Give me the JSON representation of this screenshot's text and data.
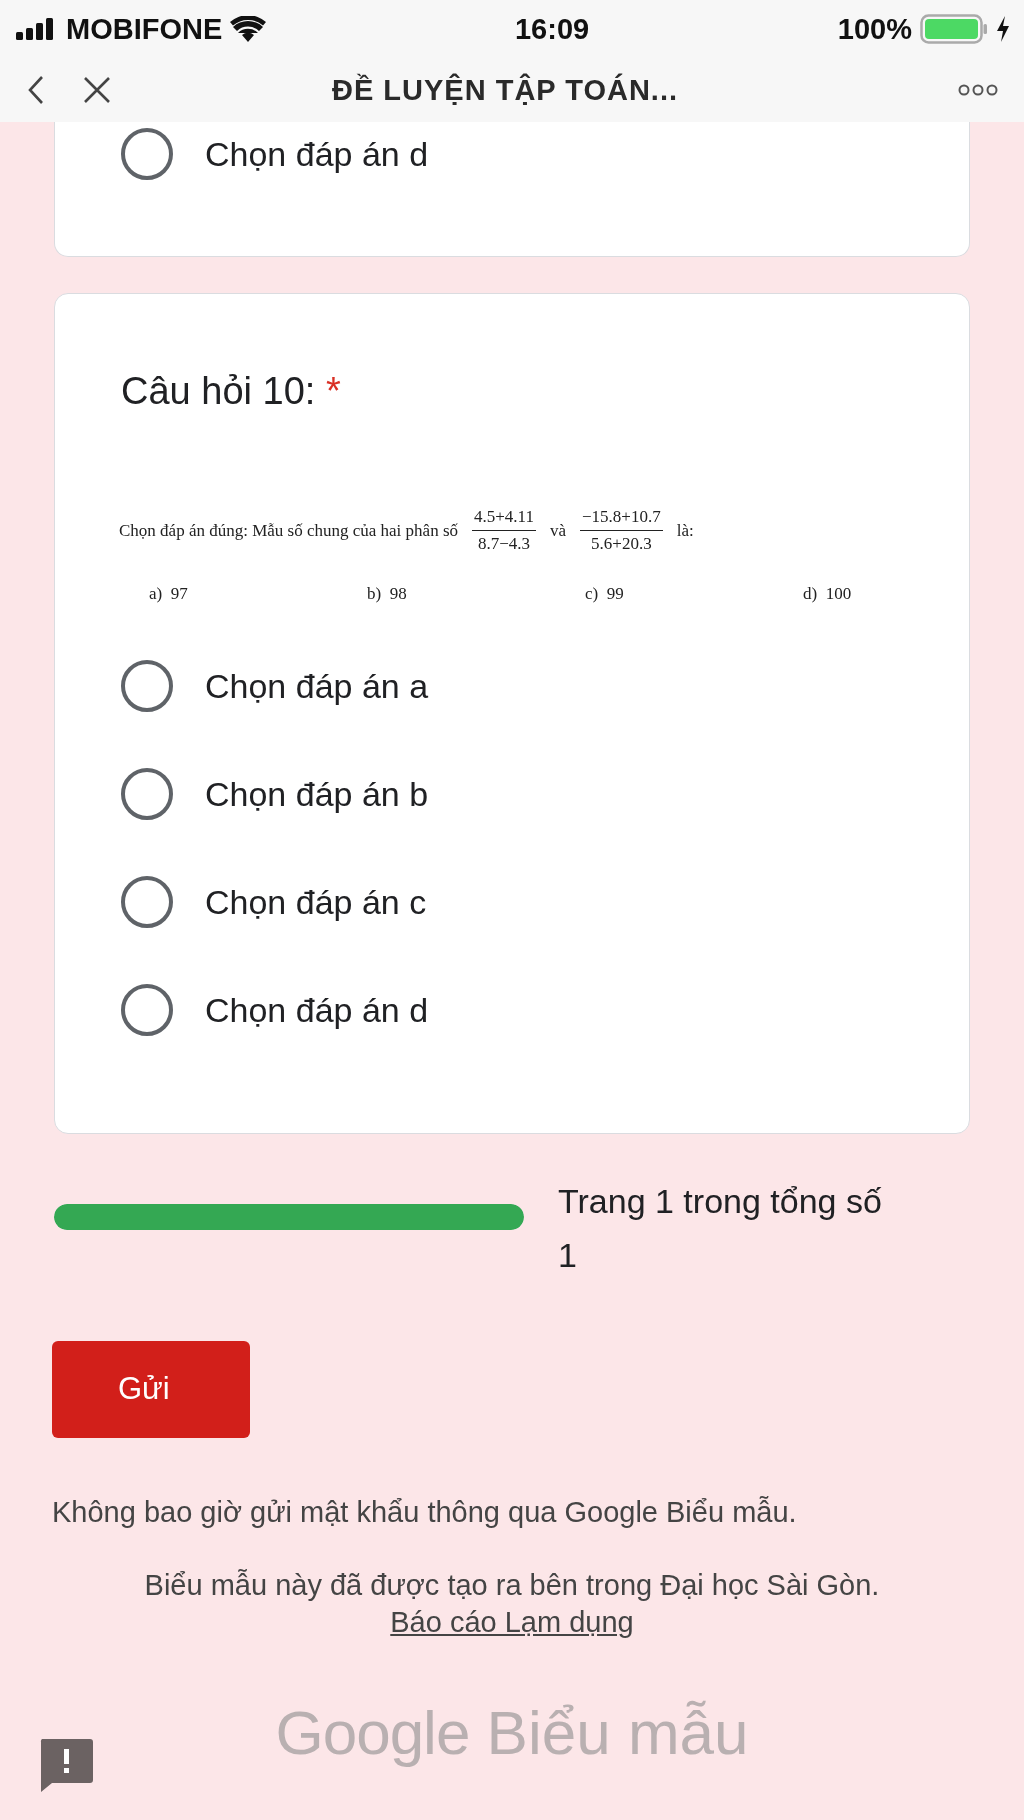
{
  "status_bar": {
    "carrier": "MOBIFONE",
    "time": "16:09",
    "battery": "100%"
  },
  "nav_bar": {
    "title": "ĐỀ LUYỆN TẬP TOÁN..."
  },
  "previous_question": {
    "options": [
      {
        "label": "Chọn đáp án d",
        "selected": false
      }
    ]
  },
  "question": {
    "title": "Câu hỏi 10:",
    "required_mark": "*",
    "problem": {
      "text_before": "Chọn đáp án đúng: Mẫu số chung của hai phân số",
      "fraction_1": {
        "numerator": "4.5+4.11",
        "denominator": "8.7−4.3"
      },
      "conjunction": "và",
      "fraction_2": {
        "numerator": "−15.8+10.7",
        "denominator": "5.6+20.3"
      },
      "text_after": "là:",
      "choices": [
        {
          "letter": "a)",
          "value": "97"
        },
        {
          "letter": "b)",
          "value": "98"
        },
        {
          "letter": "c)",
          "value": "99"
        },
        {
          "letter": "d)",
          "value": "100"
        }
      ]
    },
    "options": [
      {
        "label": "Chọn đáp án a",
        "selected": false
      },
      {
        "label": "Chọn đáp án b",
        "selected": false
      },
      {
        "label": "Chọn đáp án c",
        "selected": false
      },
      {
        "label": "Chọn đáp án d",
        "selected": false
      }
    ]
  },
  "progress": {
    "level": 1,
    "label": "Trang 1 trong tổng số 1"
  },
  "submit_button": "Gửi",
  "footer": {
    "password_warning": "Không bao giờ gửi mật khẩu thông qua Google Biểu mẫu.",
    "created_note": "Biểu mẫu này đã được tạo ra bên trong Đại học Sài Gòn.",
    "report_link": "Báo cáo Lạm dụng",
    "logo_google": "Google",
    "logo_forms": "Biểu mẫu"
  }
}
